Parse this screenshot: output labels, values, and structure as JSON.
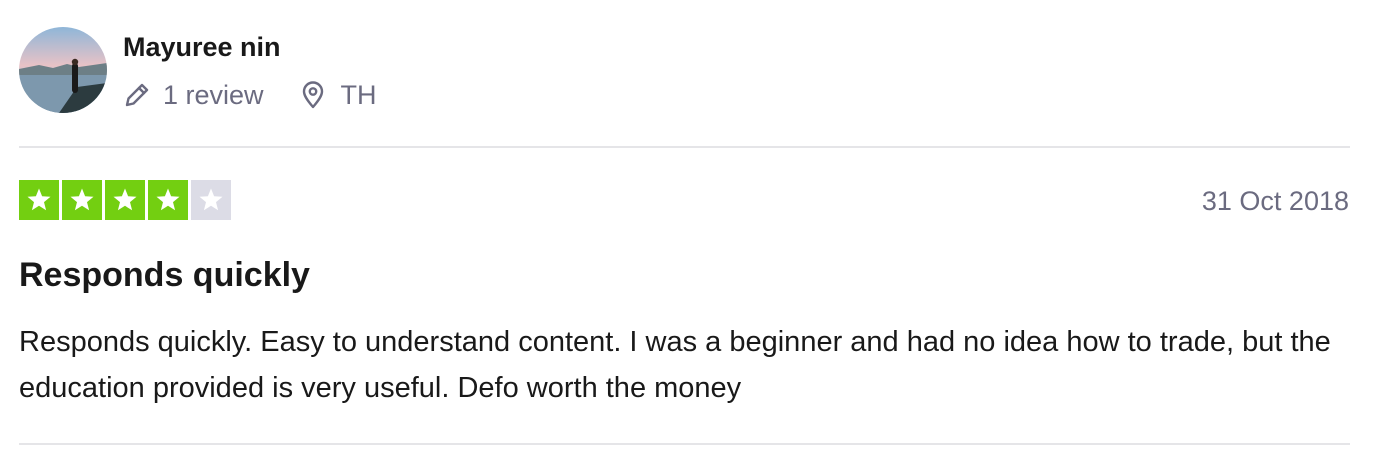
{
  "reviewer": {
    "name": "Mayuree nin",
    "avatar": "avatar-photo",
    "review_count": "1 review",
    "country": "TH",
    "icons": {
      "reviews": "pencil-icon",
      "location": "location-pin-icon"
    }
  },
  "review": {
    "rating": 4,
    "max_rating": 5,
    "date": "31 Oct 2018",
    "title": "Responds quickly",
    "body": "Responds quickly. Easy to understand content. I was a beginner and had no idea how to trade, but the education provided is very useful. Defo worth the money"
  },
  "colors": {
    "star_filled": "#73cf11",
    "star_empty": "#dcdce6",
    "meta_text": "#6b6b80",
    "divider": "#e5e5e8"
  }
}
